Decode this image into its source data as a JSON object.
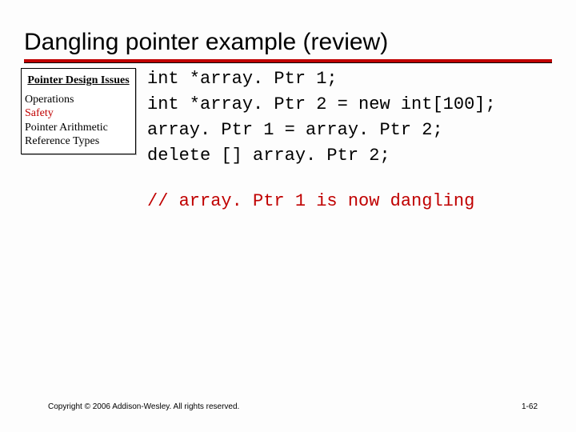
{
  "title": "Dangling pointer example (review)",
  "sidebar": {
    "heading": "Pointer Design Issues",
    "items": {
      "0": "Operations",
      "1": "Safety",
      "2": "Pointer Arithmetic",
      "3": "Reference Types"
    }
  },
  "code": {
    "l1": "int *array. Ptr 1;",
    "l2": "int *array. Ptr 2 = new int[100];",
    "l3": "array. Ptr 1 = array. Ptr 2;",
    "l4": "delete [] array. Ptr 2;",
    "comment": "// array. Ptr 1 is now dangling"
  },
  "footer": {
    "copyright": "Copyright © 2006 Addison-Wesley. All rights reserved.",
    "page": "1-62"
  }
}
